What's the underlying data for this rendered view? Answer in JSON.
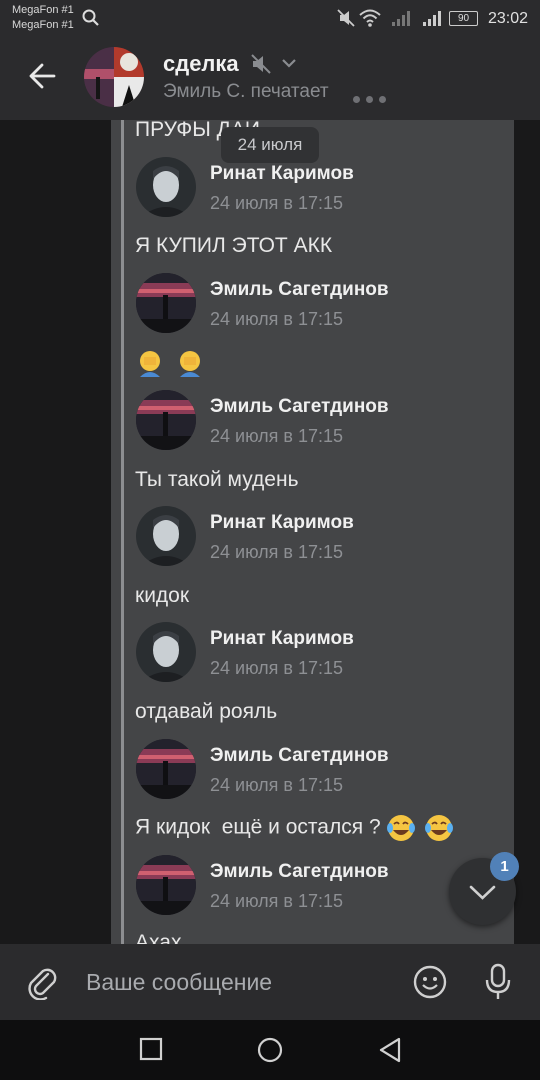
{
  "status_bar": {
    "carrier_1": "MegaFon #1",
    "carrier_2": "MegaFon #1",
    "battery": "90",
    "time": "23:02",
    "icons": [
      "search-icon",
      "mute-icon",
      "wifi-icon",
      "signal-icon",
      "signal-icon",
      "battery-icon"
    ]
  },
  "header": {
    "title": "сделка",
    "subtitle": "Эмиль С. печатает",
    "icons": [
      "back-arrow-icon",
      "mute-icon",
      "chevron-down-icon",
      "typing-dots-icon"
    ]
  },
  "chat": {
    "floating_date": "24 июля",
    "top_text": "ПРУФЫ ДАЙ",
    "messages": [
      {
        "author": "Ринат Каримов",
        "time": "24 июля в 17:15",
        "text": "Я КУПИЛ ЭТОТ АКК",
        "emoji": []
      },
      {
        "author": "Эмиль Сагетдинов",
        "time": "24 июля в 17:15",
        "text": "",
        "emoji": [
          "face-palm-emoji",
          "face-palm-emoji"
        ]
      },
      {
        "author": "Эмиль Сагетдинов",
        "time": "24 июля в 17:15",
        "text": "Ты такой мудень",
        "emoji": []
      },
      {
        "author": "Ринат Каримов",
        "time": "24 июля в 17:15",
        "text": "кидок",
        "emoji": []
      },
      {
        "author": "Ринат Каримов",
        "time": "24 июля в 17:15",
        "text": "отдавай рояль",
        "emoji": []
      },
      {
        "author": "Эмиль Сагетдинов",
        "time": "24 июля в 17:15",
        "text": "Я кидок  ещё и остался ?",
        "emoji": [
          "tears-of-joy-emoji",
          "tears-of-joy-emoji"
        ]
      },
      {
        "author": "Эмиль Сагетдинов",
        "time": "24 июля в 17:15",
        "text": "Ахах",
        "emoji": []
      }
    ],
    "unread_badge": "1"
  },
  "composer": {
    "placeholder": "Ваше сообщение",
    "icons": [
      "attach-icon",
      "emoji-icon",
      "mic-icon"
    ]
  },
  "nav": {
    "icons": [
      "recents-square-icon",
      "home-circle-icon",
      "back-triangle-icon"
    ]
  },
  "colors": {
    "background": "#19191a",
    "bar": "#2b2b2d",
    "forward_block": "#444547",
    "accent_badge": "#5181b8",
    "muted_text": "#8e9094"
  }
}
